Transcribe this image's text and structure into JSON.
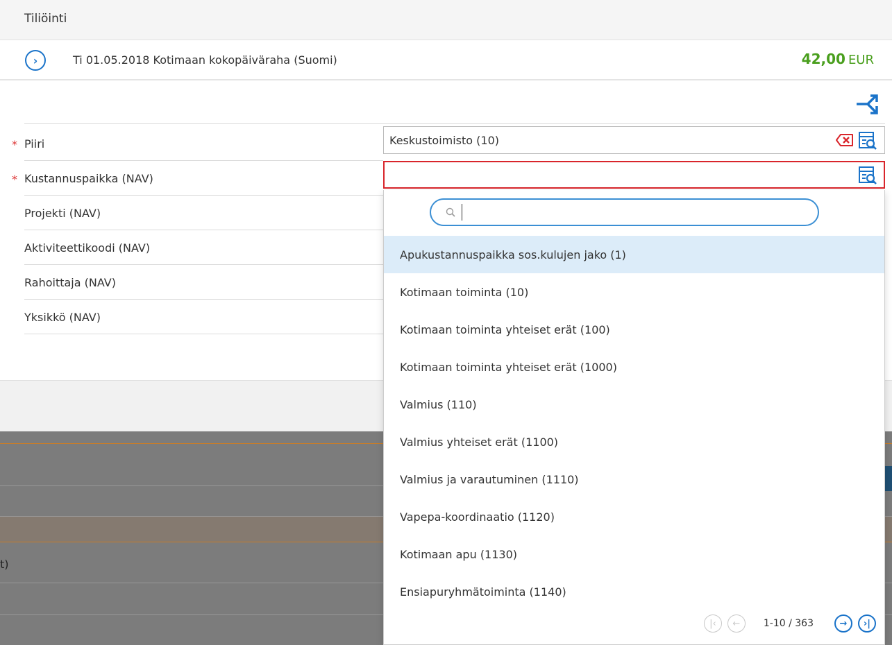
{
  "header": {
    "title": "Tiliöinti"
  },
  "entry": {
    "description": "Ti 01.05.2018  Kotimaan kokopäiväraha (Suomi)",
    "amount": "42,00",
    "currency": "EUR",
    "expand_icon": "chevron-right-circle-icon",
    "split_icon": "split-arrow-icon"
  },
  "form": {
    "fields": [
      {
        "label": "Piiri",
        "required": true,
        "value": "Keskustoimisto (10)"
      },
      {
        "label": "Kustannuspaikka (NAV)",
        "required": true,
        "value": ""
      },
      {
        "label": "Projekti (NAV)",
        "required": false
      },
      {
        "label": " Aktiviteettikoodi (NAV)",
        "required": false
      },
      {
        "label": "Rahoittaja (NAV)",
        "required": false
      },
      {
        "label": "Yksikkö (NAV)",
        "required": false
      }
    ],
    "required_mark": "*"
  },
  "background_text": "t)",
  "dropdown": {
    "search_placeholder": "",
    "items": [
      "Apukustannuspaikka sos.kulujen jako (1)",
      "Kotimaan toiminta (10)",
      "Kotimaan toiminta yhteiset erät (100)",
      "Kotimaan toiminta yhteiset erät (1000)",
      "Valmius (110)",
      "Valmius yhteiset erät (1100)",
      "Valmius ja varautuminen (1110)",
      "Vapepa-koordinaatio (1120)",
      "Kotimaan apu (1130)",
      "Ensiapuryhmätoiminta (1140)"
    ],
    "pager": {
      "range": "1-10 / 363",
      "first_icon": "first-page-icon",
      "prev_icon": "prev-page-icon",
      "next_icon": "next-page-icon",
      "last_icon": "last-page-icon"
    }
  },
  "colors": {
    "accent": "#1a73c9",
    "amount": "#4a9f1e",
    "required": "#d33333",
    "invalid_border": "#d9252b",
    "highlight": "#dcecf9"
  }
}
